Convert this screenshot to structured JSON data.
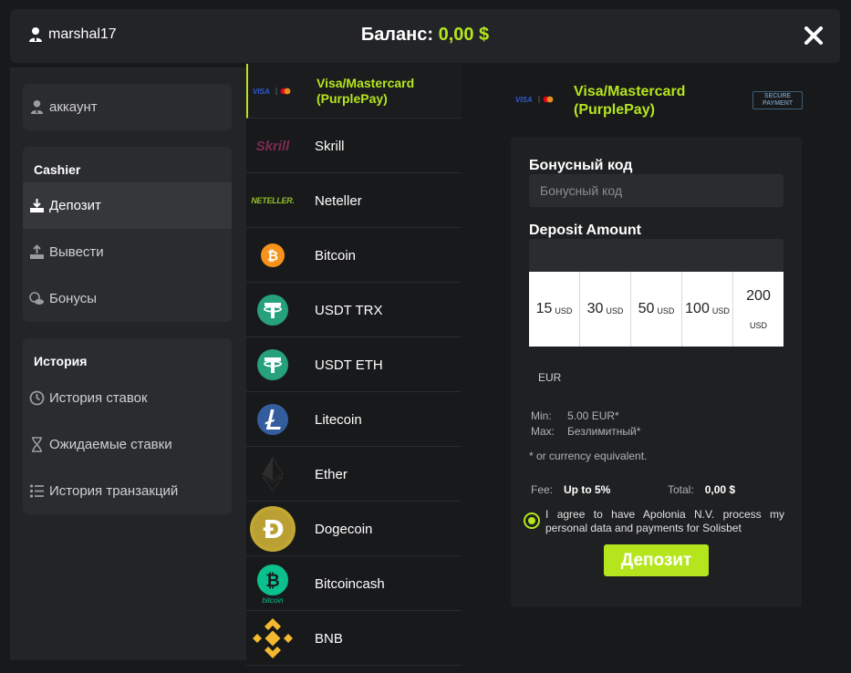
{
  "header": {
    "username": "marshal17",
    "balance_label": "Баланс:",
    "balance_value": "0,00 $"
  },
  "sidebar": {
    "account_label": "аккаунт",
    "cashier_heading": "Cashier",
    "cashier_items": [
      {
        "label": "Депозит",
        "icon": "deposit-icon",
        "active": true
      },
      {
        "label": "Вывести",
        "icon": "withdraw-icon"
      },
      {
        "label": "Бонусы",
        "icon": "bonus-icon"
      }
    ],
    "history_heading": "История",
    "history_items": [
      {
        "label": "История ставок",
        "icon": "clock-icon"
      },
      {
        "label": "Ожидаемые ставки",
        "icon": "hourglass-icon"
      },
      {
        "label": "История транзакций",
        "icon": "list-icon"
      }
    ]
  },
  "methods": [
    {
      "name": "Visa/Mastercard (PurplePay)",
      "icon": "visa-mastercard-icon",
      "active": true
    },
    {
      "name": "Skrill",
      "icon": "skrill-icon",
      "logo_text": "Skrill"
    },
    {
      "name": "Neteller",
      "icon": "neteller-icon",
      "logo_text": "NETELLER."
    },
    {
      "name": "Bitcoin",
      "icon": "bitcoin-icon"
    },
    {
      "name": "USDT TRX",
      "icon": "tether-icon"
    },
    {
      "name": "USDT ETH",
      "icon": "tether-icon"
    },
    {
      "name": "Litecoin",
      "icon": "litecoin-icon"
    },
    {
      "name": "Ether",
      "icon": "ether-icon"
    },
    {
      "name": "Dogecoin",
      "icon": "dogecoin-icon"
    },
    {
      "name": "Bitcoincash",
      "icon": "bitcoincash-icon",
      "logo_text": "bitcoin"
    },
    {
      "name": "BNB",
      "icon": "bnb-icon"
    }
  ],
  "selected": {
    "line1": "Visa/Mastercard",
    "line2": "(PurplePay)",
    "secure_line1": "SECURE",
    "secure_line2": "PAYMENT"
  },
  "form": {
    "bonus_label": "Бонусный код",
    "bonus_placeholder": "Бонусный код",
    "amount_label": "Deposit Amount",
    "presets": [
      {
        "value": "15",
        "currency": "USD"
      },
      {
        "value": "30",
        "currency": "USD"
      },
      {
        "value": "50",
        "currency": "USD"
      },
      {
        "value": "100",
        "currency": "USD"
      },
      {
        "value": "200",
        "currency": "USD"
      }
    ],
    "currency": "EUR",
    "min_label": "Min:",
    "min_value": "5.00 EUR*",
    "max_label": "Max:",
    "max_value": "Безлимитный*",
    "note": "* or currency equivalent.",
    "fee_label": "Fee:",
    "fee_value": "Up to 5%",
    "total_label": "Total:",
    "total_value": "0,00 $",
    "agree_text": "I agree to have Apolonia N.V. process my personal data and payments for Solisbet",
    "deposit_button": "Депозит"
  },
  "colors": {
    "accent": "#b5e61d",
    "panel": "#232427",
    "background": "#18191b"
  }
}
